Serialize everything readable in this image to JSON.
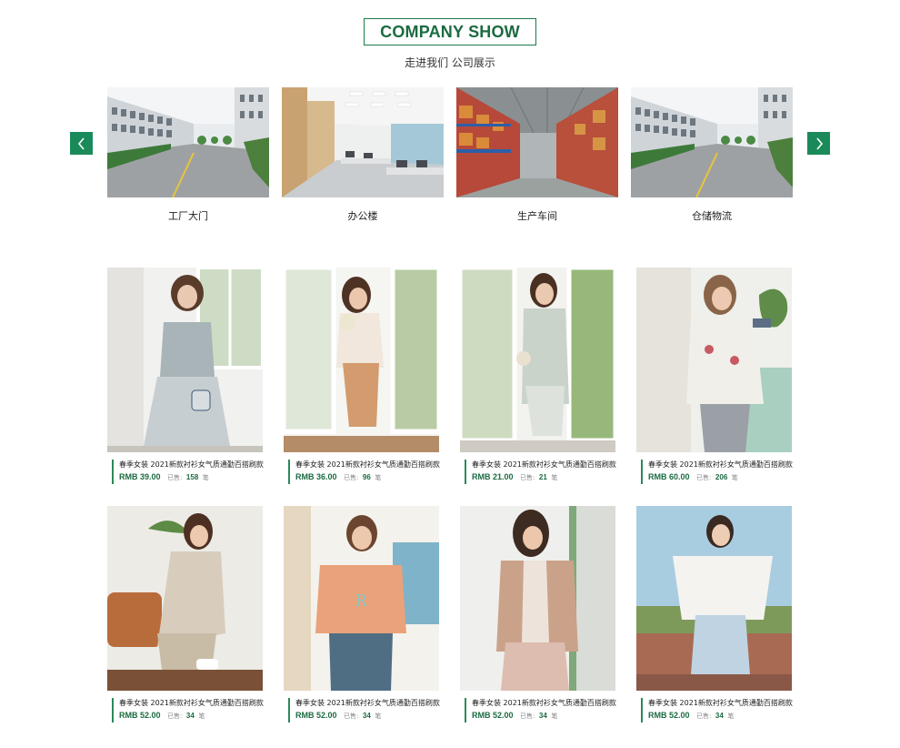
{
  "section": {
    "title": "COMPANY SHOW",
    "subtitle": "走进我们 公司展示"
  },
  "carousel": {
    "prev_icon": "chevron-left-icon",
    "next_icon": "chevron-right-icon",
    "items": [
      {
        "label": "工厂大门",
        "image": "factory-gate-photo"
      },
      {
        "label": "办公楼",
        "image": "office-interior-photo"
      },
      {
        "label": "生产车间",
        "image": "warehouse-shelves-photo"
      },
      {
        "label": "仓储物流",
        "image": "factory-gate-photo"
      }
    ]
  },
  "products": [
    {
      "title": "春季女装 2021新款衬衫女气质通勤百搭刷款",
      "price": "RMB 39.00",
      "sold_label": "已售:",
      "sold_count": "158",
      "sold_unit": "笔"
    },
    {
      "title": "春季女装 2021新款衬衫女气质通勤百搭刷款",
      "price": "RMB 36.00",
      "sold_label": "已售:",
      "sold_count": "96",
      "sold_unit": "笔"
    },
    {
      "title": "春季女装 2021新款衬衫女气质通勤百搭刷款",
      "price": "RMB 21.00",
      "sold_label": "已售:",
      "sold_count": "21",
      "sold_unit": "笔"
    },
    {
      "title": "春季女装 2021新款衬衫女气质通勤百搭刷款",
      "price": "RMB 60.00",
      "sold_label": "已售:",
      "sold_count": "206",
      "sold_unit": "笔"
    },
    {
      "title": "春季女装 2021新款衬衫女气质通勤百搭刷款",
      "price": "RMB 52.00",
      "sold_label": "已售:",
      "sold_count": "34",
      "sold_unit": "笔"
    },
    {
      "title": "春季女装 2021新款衬衫女气质通勤百搭刷款",
      "price": "RMB 52.00",
      "sold_label": "已售:",
      "sold_count": "34",
      "sold_unit": "笔"
    },
    {
      "title": "春季女装 2021新款衬衫女气质通勤百搭刷款",
      "price": "RMB 52.00",
      "sold_label": "已售:",
      "sold_count": "34",
      "sold_unit": "笔"
    },
    {
      "title": "春季女装 2021新款衬衫女气质通勤百搭刷款",
      "price": "RMB 52.00",
      "sold_label": "已售:",
      "sold_count": "34",
      "sold_unit": "笔"
    }
  ],
  "colors": {
    "brand_green": "#1b6b41",
    "arrow_green": "#1b8a5a"
  }
}
